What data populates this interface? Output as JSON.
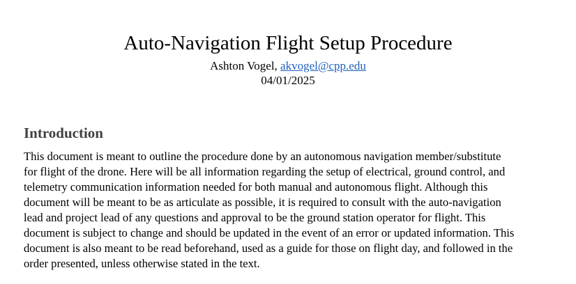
{
  "document": {
    "title": "Auto-Navigation Flight Setup Procedure",
    "author": "Ashton Vogel,",
    "email": "akvogel@cpp.edu",
    "date": "04/01/2025"
  },
  "introduction": {
    "heading": "Introduction",
    "lines": [
      "This document is meant to outline the procedure done by an autonomous navigation member/substitute",
      "for flight of the drone. Here will be all information regarding the setup of electrical, ground control, and",
      "telemetry communication information needed for both manual and autonomous flight. Although this",
      "document will be meant to be as articulate as possible, it is required to consult with the auto-navigation",
      "lead and project lead of any questions and approval to be the ground station operator for flight. This",
      "document is subject to change and should be updated in the event of an error or updated information. This",
      "document is also meant to be read beforehand, used as a guide for those on flight day, and followed in the",
      "order presented, unless otherwise stated in the text."
    ]
  },
  "colors": {
    "link": "#1f5fbf",
    "heading": "#404040",
    "text": "#000000"
  }
}
